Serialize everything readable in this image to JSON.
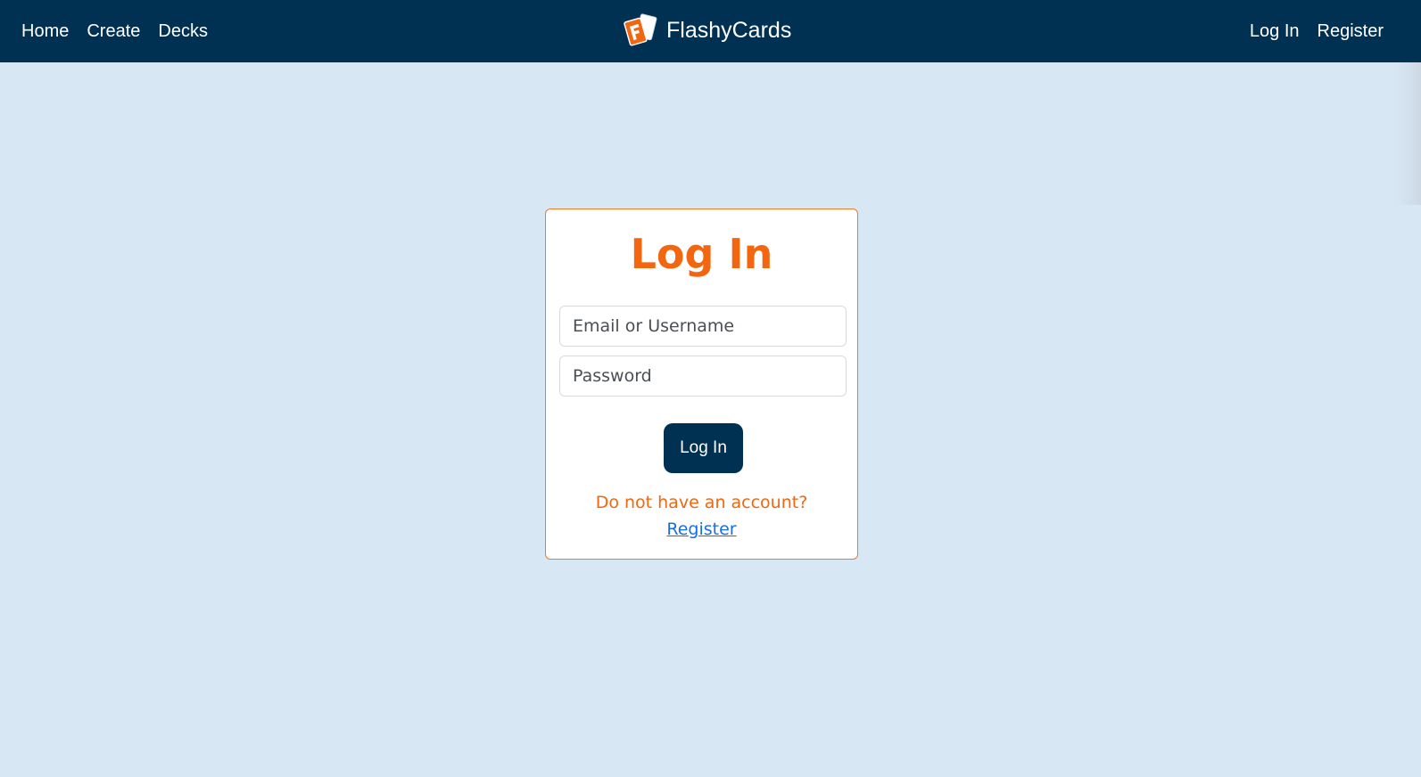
{
  "nav": {
    "left_links": [
      "Home",
      "Create",
      "Decks"
    ],
    "brand": "FlashyCards",
    "right_links": [
      "Log In",
      "Register"
    ]
  },
  "login_card": {
    "title": "Log In",
    "email_placeholder": "Email or Username",
    "password_placeholder": "Password",
    "submit_label": "Log In",
    "prompt": "Do not have an account?",
    "register_link": "Register"
  },
  "colors": {
    "nav_bg": "#003153",
    "page_bg": "#d8e7f4",
    "accent": "#f26610",
    "link": "#1a6fe0"
  },
  "icons": {
    "brand_logo": "flashcards-logo-icon"
  }
}
